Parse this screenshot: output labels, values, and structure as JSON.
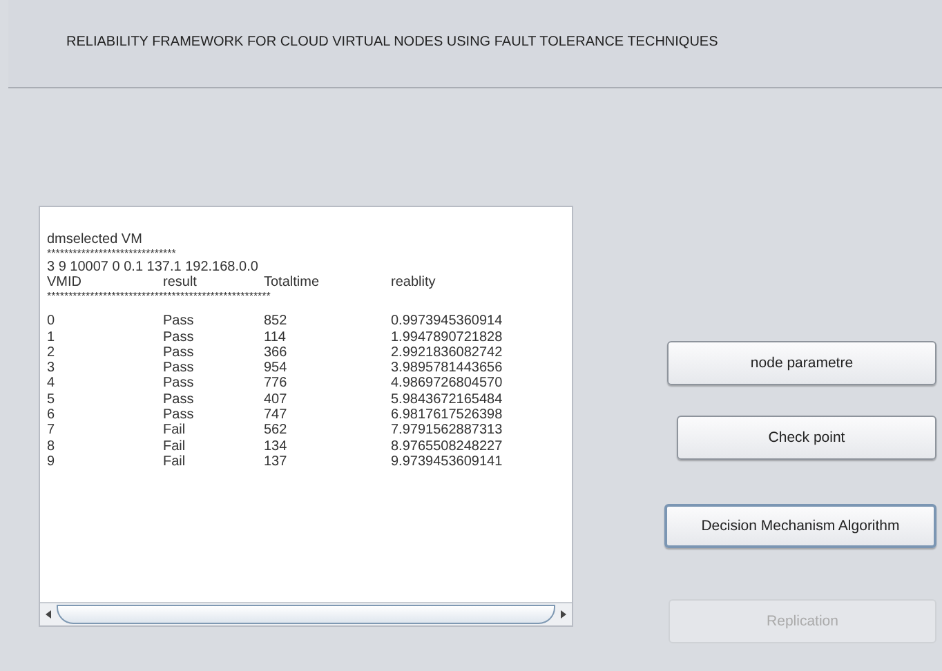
{
  "window": {
    "title": "RELIABILITY FRAMEWORK FOR CLOUD VIRTUAL NODES USING FAULT TOLERANCE TECHNIQUES"
  },
  "output": {
    "heading": "dmselected VM",
    "separator_1": "******************************",
    "info_line": "3 9 10007 0 0.1 137.1 192.168.0.0",
    "columns": [
      "VMID",
      "result",
      "Totaltime",
      "reablity"
    ],
    "separator_2": "****************************************************",
    "rows": [
      {
        "cells": [
          "0",
          "Pass",
          "852",
          "0.9973945360914"
        ]
      },
      {
        "cells": [
          "1",
          "Pass",
          "114",
          "1.9947890721828"
        ]
      },
      {
        "cells": [
          "2",
          "Pass",
          "366",
          "2.9921836082742"
        ]
      },
      {
        "cells": [
          "3",
          "Pass",
          "954",
          "3.9895781443656"
        ]
      },
      {
        "cells": [
          "4",
          "Pass",
          "776",
          "4.9869726804570"
        ]
      },
      {
        "cells": [
          "5",
          "Pass",
          "407",
          "5.9843672165484"
        ]
      },
      {
        "cells": [
          "6",
          "Pass",
          "747",
          "6.9817617526398"
        ]
      },
      {
        "cells": [
          "7",
          "Fail",
          "562",
          "7.9791562887313"
        ]
      },
      {
        "cells": [
          "8",
          "Fail",
          "134",
          "8.9765508248227"
        ]
      },
      {
        "cells": [
          "9",
          "Fail",
          "137",
          "9.9739453609141"
        ]
      }
    ]
  },
  "buttons": [
    {
      "label": "node parametre",
      "disabled": false,
      "focused": false
    },
    {
      "label": "Check point",
      "disabled": false,
      "focused": false
    },
    {
      "label": "Decision Mechanism Algorithm",
      "disabled": false,
      "focused": true
    },
    {
      "label": "Replication",
      "disabled": true,
      "focused": false
    }
  ]
}
